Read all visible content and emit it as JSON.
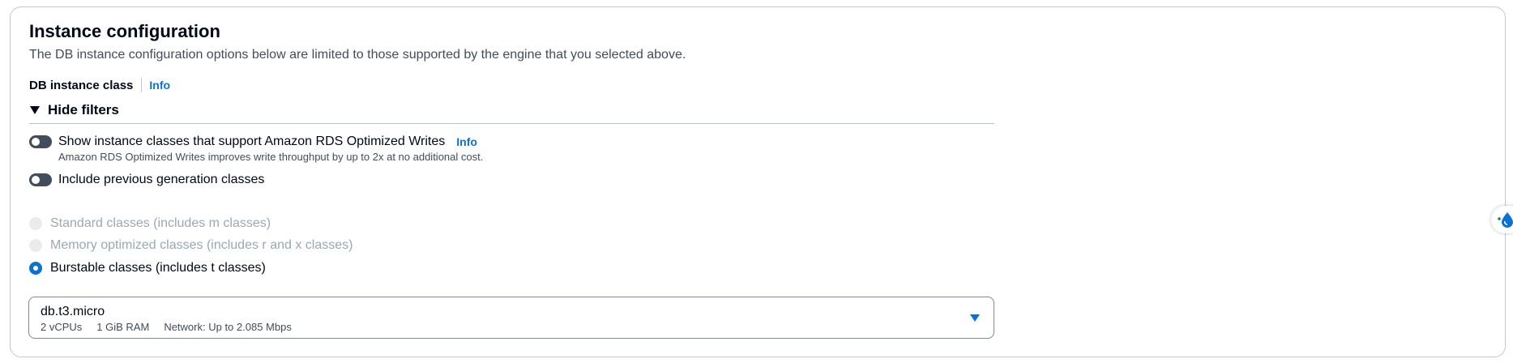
{
  "section": {
    "title": "Instance configuration",
    "description": "The DB instance configuration options below are limited to those supported by the engine that you selected above."
  },
  "db_instance_class": {
    "label": "DB instance class",
    "info_label": "Info"
  },
  "filters": {
    "toggle_label": "Hide filters",
    "expanded": true
  },
  "toggles": [
    {
      "label": "Show instance classes that support Amazon RDS Optimized Writes",
      "info_label": "Info",
      "description": "Amazon RDS Optimized Writes improves write throughput by up to 2x at no additional cost.",
      "checked": false
    },
    {
      "label": "Include previous generation classes",
      "checked": false
    }
  ],
  "class_options": [
    {
      "label": "Standard classes (includes m classes)",
      "state": "disabled"
    },
    {
      "label": "Memory optimized classes (includes r and x classes)",
      "state": "disabled"
    },
    {
      "label": "Burstable classes (includes t classes)",
      "state": "selected"
    }
  ],
  "instance_select": {
    "value": "db.t3.micro",
    "tags": [
      "2 vCPUs",
      "1 GiB RAM",
      "Network: Up to 2.085 Mbps"
    ]
  },
  "side_widget": {
    "icon": "water-drop-icon"
  },
  "colors": {
    "accent": "#0972d3",
    "toggle_off": "#414d5c",
    "disabled": "#9ba7b6"
  }
}
